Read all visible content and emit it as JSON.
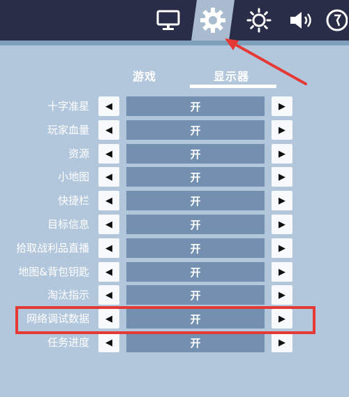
{
  "top_tabs": [
    {
      "icon": "monitor-icon"
    },
    {
      "icon": "gear-icon",
      "active": true
    },
    {
      "icon": "brightness-icon"
    },
    {
      "icon": "volume-icon"
    },
    {
      "icon": "accessibility-icon"
    }
  ],
  "subtabs": {
    "game": "游戏",
    "display": "显示器",
    "active": "display"
  },
  "settings": [
    {
      "label": "十字准星",
      "value": "开"
    },
    {
      "label": "玩家血量",
      "value": "开"
    },
    {
      "label": "资源",
      "value": "开"
    },
    {
      "label": "小地图",
      "value": "开"
    },
    {
      "label": "快捷栏",
      "value": "开"
    },
    {
      "label": "目标信息",
      "value": "开"
    },
    {
      "label": "拾取战利品直播",
      "value": "开"
    },
    {
      "label": "地图&背包钥匙",
      "value": "开"
    },
    {
      "label": "淘汰指示",
      "value": "开"
    },
    {
      "label": "网络调试数据",
      "value": "开",
      "highlighted": true
    },
    {
      "label": "任务进度",
      "value": "开"
    }
  ],
  "arrows": {
    "left": "◀",
    "right": "▶"
  },
  "colors": {
    "annotation": "#e53935",
    "topbar": "#2a2d47",
    "panel": "#b3c7dc",
    "value_box": "#7390b0"
  }
}
